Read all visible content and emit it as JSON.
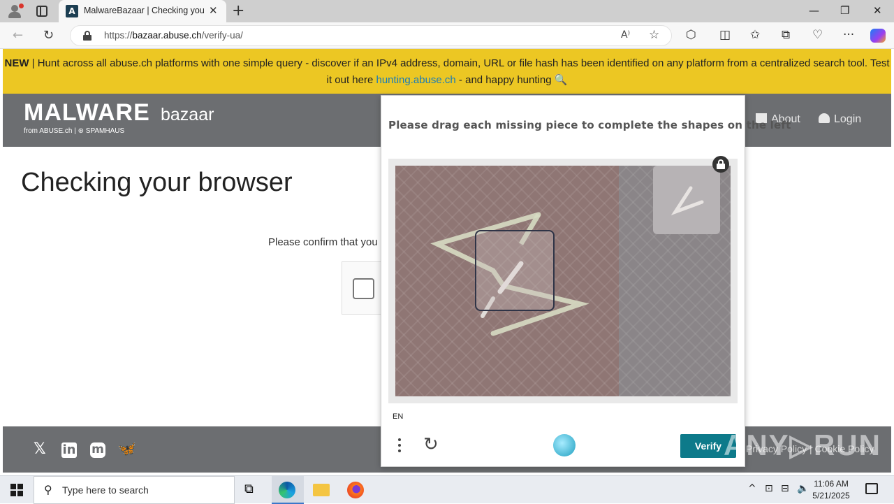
{
  "browser": {
    "tab_title": "MalwareBazaar | Checking your b",
    "tab_close": "✕",
    "new_tab": "+",
    "url_host": "bazaar.abuse.ch",
    "url_prefix": "https://",
    "url_path": "/verify-ua/",
    "window_minimize": "—",
    "window_restore": "❐",
    "window_close": "✕"
  },
  "banner": {
    "new_label": "NEW",
    "text_before": " | Hunt across all abuse.ch platforms with one simple query - discover if an IPv4 address, domain, URL or file hash has been identified on any platform from a centralized search tool. Test it out here ",
    "link_text": "hunting.abuse.ch",
    "text_after": " - and happy hunting 🔍"
  },
  "header": {
    "logo_main": "MALWARE",
    "logo_sub": "bazaar",
    "logo_from": "from ABUSE.ch | ⊛ SPAMHAUS",
    "nav": [
      {
        "label": "About"
      },
      {
        "label": "Login"
      }
    ]
  },
  "main": {
    "title": "Checking your browser",
    "confirm_text": "Please confirm that you are human"
  },
  "captcha": {
    "prompt": "Please drag each missing piece to complete the shapes on the left",
    "language": "EN",
    "verify_label": "Verify"
  },
  "footer": {
    "social": [
      "𝕏",
      "in",
      "m",
      "🦋"
    ],
    "links": "Privacy Policy  |  Cookie Policy"
  },
  "watermark": "ANY▷RUN",
  "taskbar": {
    "search_placeholder": "Type here to search",
    "time": "11:06 AM",
    "date": "5/21/2025"
  },
  "colors": {
    "banner": "#ecc723",
    "header": "#6c6e71",
    "verify": "#0d7a8a",
    "link": "#1a7cb8"
  }
}
